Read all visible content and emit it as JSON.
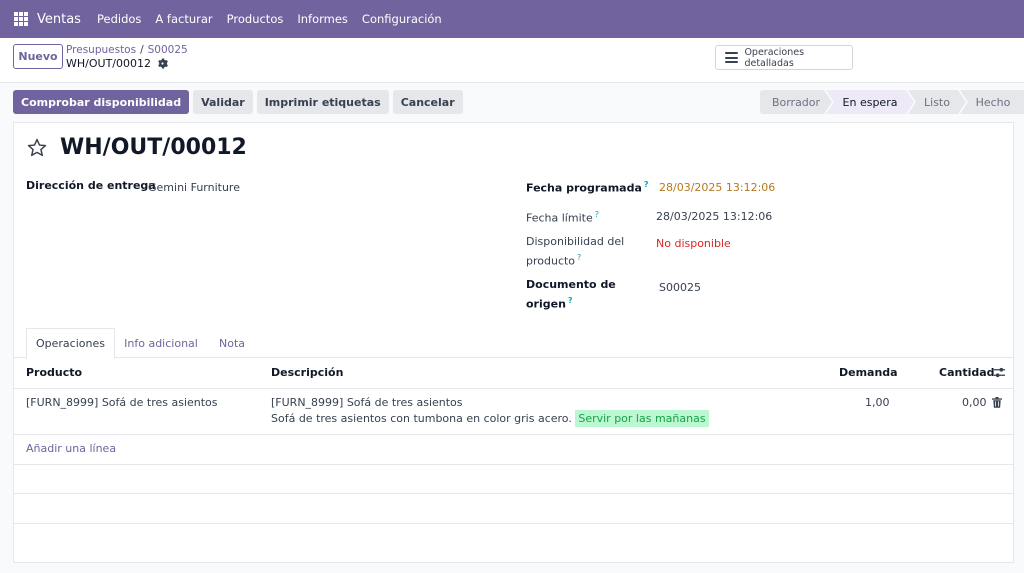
{
  "navbar": {
    "app_title": "Ventas",
    "menu": [
      "Pedidos",
      "A facturar",
      "Productos",
      "Informes",
      "Configuración"
    ]
  },
  "control": {
    "new_label": "Nuevo",
    "breadcrumb": [
      "Presupuestos",
      "S00025"
    ],
    "record": "WH/OUT/00012",
    "detailed_ops_label": "Operaciones detalladas"
  },
  "actions": {
    "check_availability": "Comprobar disponibilidad",
    "validate": "Validar",
    "print_labels": "Imprimir etiquetas",
    "cancel": "Cancelar"
  },
  "status_stages": [
    "Borrador",
    "En espera",
    "Listo",
    "Hecho"
  ],
  "active_stage": "En espera",
  "form": {
    "title": "WH/OUT/00012",
    "delivery_address_label": "Dirección de entrega",
    "delivery_address": "Gemini Furniture",
    "scheduled_date_label": "Fecha programada",
    "scheduled_date": "28/03/2025 13:12:06",
    "deadline_label": "Fecha límite",
    "deadline": "28/03/2025 13:12:06",
    "availability_label_1": "Disponibilidad del",
    "availability_label_2": "producto",
    "availability": "No disponible",
    "origin_label_1": "Documento de",
    "origin_label_2": "origen",
    "origin": "S00025",
    "help_mark": "?"
  },
  "tabs": [
    "Operaciones",
    "Info adicional",
    "Nota"
  ],
  "table": {
    "headers": {
      "product": "Producto",
      "description": "Descripción",
      "demand": "Demanda",
      "quantity": "Cantidad"
    },
    "rows": [
      {
        "product": "[FURN_8999] Sofá de tres asientos",
        "description_1": "[FURN_8999] Sofá de tres asientos",
        "description_2": "Sofá de tres asientos con tumbona en color gris acero.",
        "description_highlight": "Servir por las mañanas",
        "demand": "1,00",
        "quantity": "0,00"
      }
    ],
    "add_line": "Añadir una línea"
  },
  "icons": {
    "apps": "apps-grid-icon",
    "gear": "gear-icon",
    "menu": "hamburger-icon",
    "star": "star-icon",
    "trash": "trash-icon",
    "adjust": "sliders-icon"
  }
}
